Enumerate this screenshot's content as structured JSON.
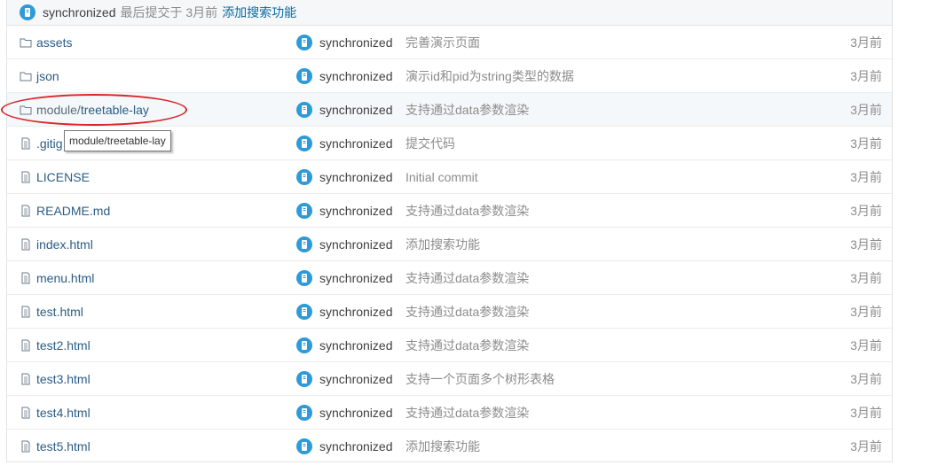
{
  "commit_bar": {
    "author": "synchronized",
    "meta": "最后提交于 3月前",
    "message": "添加搜索功能"
  },
  "files": [
    {
      "type": "folder",
      "name": "assets",
      "author": "synchronized",
      "message": "完善演示页面",
      "time": "3月前"
    },
    {
      "type": "folder",
      "name": "json",
      "author": "synchronized",
      "message": "演示id和pid为string类型的数据",
      "time": "3月前"
    },
    {
      "type": "folder",
      "prefix": "module/ ",
      "name": "treetable-lay",
      "author": "synchronized",
      "message": "支持通过data参数渲染",
      "time": "3月前"
    },
    {
      "type": "file",
      "name": ".gitig",
      "author": "synchronized",
      "message": "提交代码",
      "time": "3月前"
    },
    {
      "type": "file",
      "name": "LICENSE",
      "author": "synchronized",
      "message": "Initial commit",
      "time": "3月前"
    },
    {
      "type": "file",
      "name": "README.md",
      "author": "synchronized",
      "message": "支持通过data参数渲染",
      "time": "3月前"
    },
    {
      "type": "file",
      "name": "index.html",
      "author": "synchronized",
      "message": "添加搜索功能",
      "time": "3月前"
    },
    {
      "type": "file",
      "name": "menu.html",
      "author": "synchronized",
      "message": "支持通过data参数渲染",
      "time": "3月前"
    },
    {
      "type": "file",
      "name": "test.html",
      "author": "synchronized",
      "message": "支持通过data参数渲染",
      "time": "3月前"
    },
    {
      "type": "file",
      "name": "test2.html",
      "author": "synchronized",
      "message": "支持通过data参数渲染",
      "time": "3月前"
    },
    {
      "type": "file",
      "name": "test3.html",
      "author": "synchronized",
      "message": "支持一个页面多个树形表格",
      "time": "3月前"
    },
    {
      "type": "file",
      "name": "test4.html",
      "author": "synchronized",
      "message": "支持通过data参数渲染",
      "time": "3月前"
    },
    {
      "type": "file",
      "name": "test5.html",
      "author": "synchronized",
      "message": "添加搜索功能",
      "time": "3月前"
    }
  ],
  "tooltip": "module/treetable-lay",
  "highlight_color": "#d9262c",
  "avatar_color": "#2f9ad8"
}
